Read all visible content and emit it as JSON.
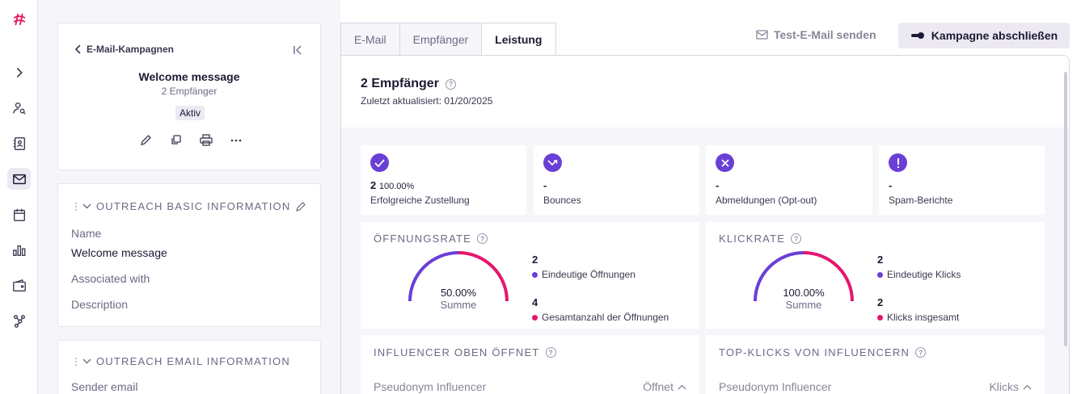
{
  "sidebar": {
    "icons": [
      "hashtag-logo-icon",
      "chevron-right-icon",
      "user-search-icon",
      "contacts-book-icon",
      "mail-icon",
      "calendar-icon",
      "bar-chart-icon",
      "wallet-icon",
      "workflow-icon"
    ]
  },
  "campaign_card": {
    "back_label": "E-Mail-Kampagnen",
    "title": "Welcome message",
    "recipients": "2 Empfänger",
    "status": "Aktiv"
  },
  "basic_info": {
    "heading": "OUTREACH BASIC INFORMATION",
    "name_label": "Name",
    "name_value": "Welcome message",
    "associated_label": "Associated with",
    "description_label": "Description"
  },
  "email_info": {
    "heading": "OUTREACH EMAIL INFORMATION",
    "sender_label": "Sender email"
  },
  "tabs": [
    {
      "label": "E-Mail",
      "active": false
    },
    {
      "label": "Empfänger",
      "active": false
    },
    {
      "label": "Leistung",
      "active": true
    }
  ],
  "toolbar": {
    "test_email": "Test-E-Mail senden",
    "finish_campaign": "Kampagne abschließen"
  },
  "performance": {
    "title": "2 Empfänger",
    "updated": "Zuletzt aktualisiert: 01/20/2025",
    "stats": [
      {
        "icon": "check-icon",
        "value": "2",
        "percent": "100.00%",
        "label": "Erfolgreiche Zustellung"
      },
      {
        "icon": "bounce-icon",
        "value": "-",
        "percent": "",
        "label": "Bounces"
      },
      {
        "icon": "x-icon",
        "value": "-",
        "percent": "",
        "label": "Abmeldungen (Opt-out)"
      },
      {
        "icon": "exclamation-icon",
        "value": "-",
        "percent": "",
        "label": "Spam-Berichte"
      }
    ],
    "open_rate": {
      "heading": "ÖFFNUNGSRATE",
      "value": "50.00%",
      "caption": "Summe",
      "fraction": 0.5,
      "unique_count": "2",
      "unique_label": "Eindeutige Öffnungen",
      "total_count": "4",
      "total_label": "Gesamtanzahl der Öffnungen"
    },
    "click_rate": {
      "heading": "KLICKRATE",
      "value": "100.00%",
      "caption": "Summe",
      "fraction": 1.0,
      "unique_count": "2",
      "unique_label": "Eindeutige Klicks",
      "total_count": "2",
      "total_label": "Klicks insgesamt"
    },
    "top_opens": {
      "heading": "INFLUENCER OBEN ÖFFNET",
      "col_name": "Pseudonym Influencer",
      "col_value": "Öffnet"
    },
    "top_clicks": {
      "heading": "TOP-KLICKS VON INFLUENCERN",
      "col_name": "Pseudonym Influencer",
      "col_value": "Klicks"
    }
  },
  "colors": {
    "purple": "#6a3fd6",
    "pink": "#e5166e",
    "brand": "#e8175d"
  }
}
